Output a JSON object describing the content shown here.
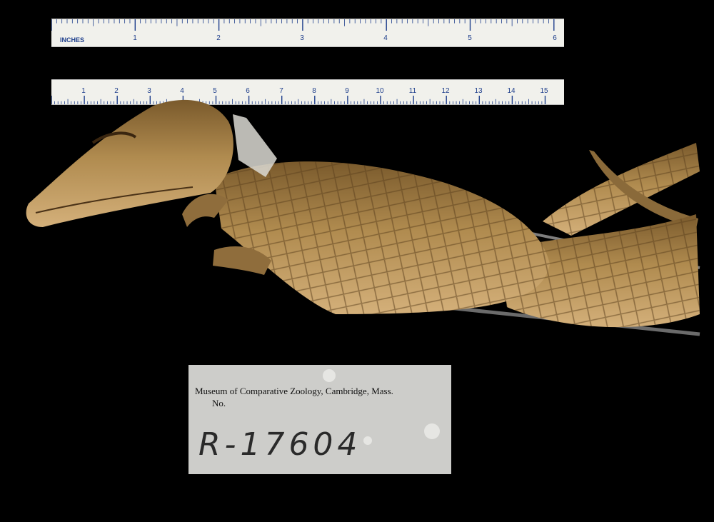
{
  "ruler_inches": {
    "unit_label": "INCHES",
    "ticks": [
      "1",
      "2",
      "3",
      "4",
      "5",
      "6"
    ],
    "colors": {
      "face": "#f1f1ec",
      "marks": "#1f3f8c"
    }
  },
  "ruler_cm": {
    "ticks": [
      "1",
      "2",
      "3",
      "4",
      "5",
      "6",
      "7",
      "8",
      "9",
      "10",
      "11",
      "12",
      "13",
      "14",
      "15"
    ]
  },
  "specimen": {
    "subject": "crocodilian-specimen-icon",
    "colors": {
      "skin": "#b08b4f",
      "shadow": "#5a3f1c",
      "belly": "#c9a36a"
    }
  },
  "label": {
    "museum": "Museum of Comparative Zoology, Cambridge, Mass.",
    "number_prefix": "No.",
    "catalog_number": "R-17604"
  }
}
